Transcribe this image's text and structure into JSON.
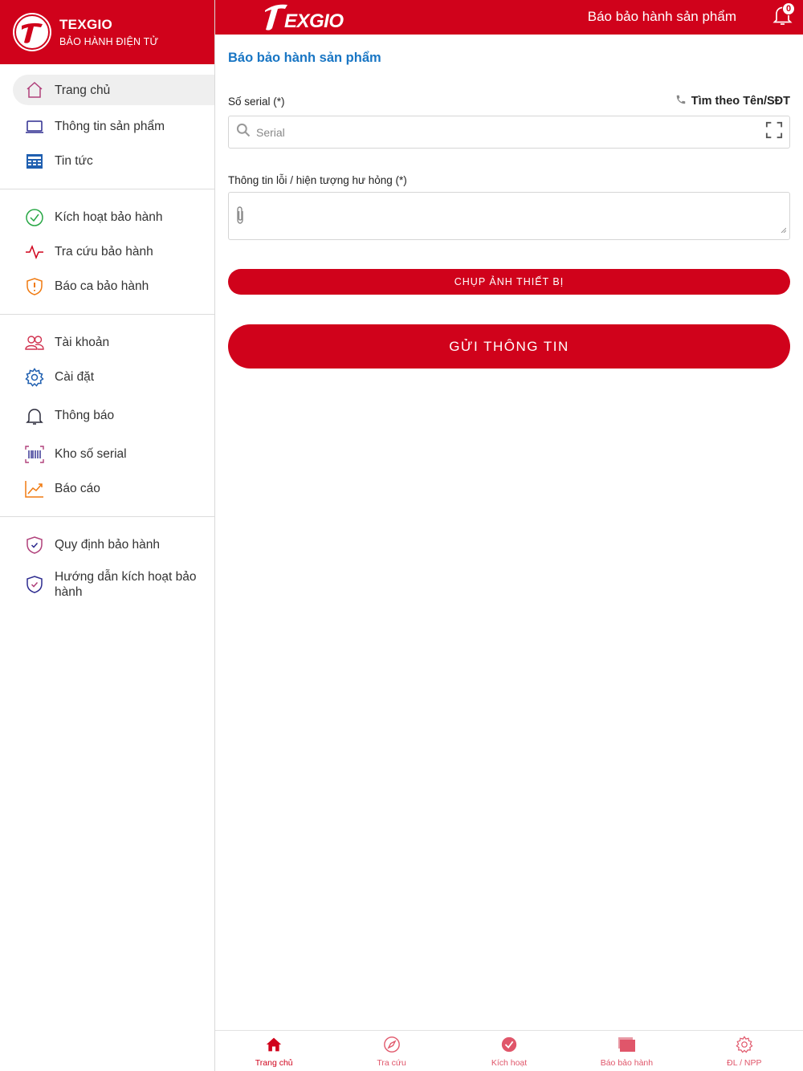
{
  "colors": {
    "brand_red": "#d0021b",
    "title_blue": "#1976c4",
    "active_bg": "#efefef"
  },
  "sidebar": {
    "brand_name": "TEXGIO",
    "brand_subtitle": "BẢO HÀNH ĐIỆN TỬ",
    "groups": [
      {
        "items": [
          {
            "label": "Trang chủ",
            "icon": "home-icon",
            "active": true
          },
          {
            "label": "Thông tin sản phẩm",
            "icon": "laptop-icon"
          },
          {
            "label": "Tin tức",
            "icon": "news-icon"
          }
        ]
      },
      {
        "items": [
          {
            "label": "Kích hoạt bảo hành",
            "icon": "check-circle-icon"
          },
          {
            "label": "Tra cứu bảo hành",
            "icon": "activity-icon"
          },
          {
            "label": "Báo ca bảo hành",
            "icon": "shield-alert-icon"
          }
        ]
      },
      {
        "items": [
          {
            "label": "Tài khoản",
            "icon": "users-icon"
          },
          {
            "label": "Cài đặt",
            "icon": "gear-icon"
          },
          {
            "label": "Thông báo",
            "icon": "bell-icon"
          },
          {
            "label": "Kho số serial",
            "icon": "barcode-icon"
          },
          {
            "label": "Báo cáo",
            "icon": "chart-icon"
          }
        ]
      },
      {
        "items": [
          {
            "label": "Quy định bảo hành",
            "icon": "shield-check-icon"
          },
          {
            "label": "Hướng dẫn kích hoạt bảo hành",
            "icon": "shield-check-icon"
          }
        ]
      }
    ]
  },
  "topbar": {
    "logo_text": "TEXGIO",
    "title": "Báo bảo hành sản phẩm",
    "notification_count": "0"
  },
  "main": {
    "page_title": "Báo bảo hành sản phẩm",
    "serial_label": "Số serial (*)",
    "find_link": "Tìm theo Tên/SĐT",
    "serial_placeholder": "Serial",
    "serial_value": "",
    "issue_label": "Thông tin lỗi / hiện tượng hư hỏng (*)",
    "issue_value": "",
    "photo_button": "CHỤP ẢNH THIẾT BỊ",
    "send_button": "GỬI THÔNG TIN"
  },
  "tabbar": {
    "tabs": [
      {
        "label": "Trang chủ",
        "icon": "home-icon",
        "active": true
      },
      {
        "label": "Tra cứu",
        "icon": "compass-icon"
      },
      {
        "label": "Kích hoạt",
        "icon": "check-circle-icon"
      },
      {
        "label": "Báo bảo hành",
        "icon": "folder-icon"
      },
      {
        "label": "ĐL / NPP",
        "icon": "gear-icon"
      }
    ]
  }
}
